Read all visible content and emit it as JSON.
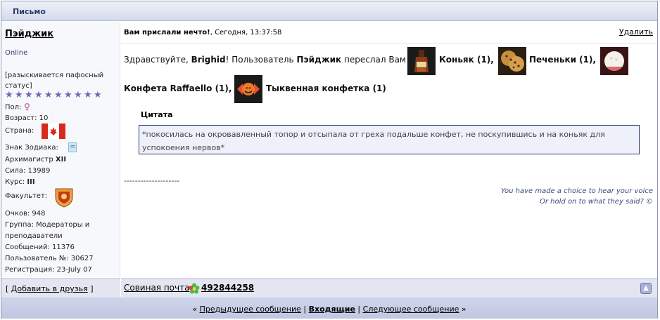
{
  "window": {
    "title": "Письмо"
  },
  "sender": {
    "name": "Пэйджик",
    "status": "Online",
    "custom_status": "[разыскивается пафосный статус]",
    "gender_label": "Пол:",
    "age": "Возраст: 10",
    "country_label": "Страна:",
    "zodiac_label": "Знак Зодиака:",
    "rank_label": "Архимагистр ",
    "rank_value": "XII",
    "power": "Сила: 13989",
    "course_label": "Курс: ",
    "course_value": "III",
    "faculty_label": "Факультет:",
    "points": "Очков: 948",
    "group_line1": "Группа: Модераторы и",
    "group_line2": "преподаватели",
    "messages": "Сообщений: 11376",
    "user_number": "Пользователь №: 30627",
    "registration": "Регистрация: 23-July 07",
    "add_friend": "Добавить в друзья"
  },
  "message": {
    "subject": "Вам прислали нечто!",
    "date": "Сегодня, 13:37:58",
    "delete_label": "Удалить",
    "greeting": "Здравствуйте, ",
    "recipient": "Brighid",
    "text_mid": "! Пользователь ",
    "sender_name": "Пэйджик",
    "text_forward": " переслал Вам ",
    "gifts": [
      {
        "name": "Коньяк (1),",
        "icon": "cognac-bottle-icon"
      },
      {
        "name": "Печеньки (1),",
        "icon": "cookies-icon"
      },
      {
        "name": "Конфета Raffaello (1),",
        "icon": "raffaello-candy-icon"
      },
      {
        "name": "Тыквенная конфетка (1)",
        "icon": "pumpkin-candy-icon"
      }
    ],
    "quote_title": "Цитата",
    "quote_text": "*покосилась на окровавленный топор и отсыпала от греха подальше конфет, не поскупившись и на коньяк для успокоения нервов*",
    "separator": "--------------------",
    "signature_line1": "You have made a choice to hear your voice",
    "signature_line2": "Or hold on to what they said? ©"
  },
  "footer": {
    "owl_mail": "Совиная почта",
    "icq_number": "492844258"
  },
  "nav": {
    "prev": "Предыдущее сообщение",
    "inbox": "Входящие",
    "next": "Следующее сообщение"
  },
  "stars": {
    "count": 10
  },
  "colors": {
    "accent": "#2d3d6e",
    "star": "#6a6ab8",
    "quote_border": "#2c3a6a"
  }
}
